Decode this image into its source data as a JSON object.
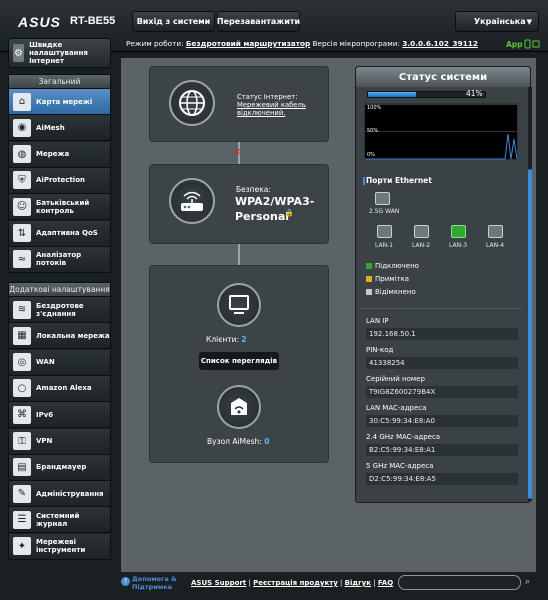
{
  "header": {
    "brand": "ASUS",
    "model": "RT-BE55",
    "logout_label": "Вихід з системи",
    "reboot_label": "Перезавантажити",
    "language": "Українська",
    "status_prefix": "Режим роботи:",
    "mode": "Бездротовий маршрутизатор",
    "fw_prefix": "Версія мікропрограми:",
    "firmware": "3.0.0.6.102_39112",
    "app_label": "App"
  },
  "sidebar": {
    "quick_setup": "Швидке налаштування Інтернет",
    "general_header": "Загальний",
    "general_items": [
      {
        "label": "Карта мережі",
        "icon": "network-map-icon"
      },
      {
        "label": "AiMesh",
        "icon": "aimesh-icon"
      },
      {
        "label": "Мережа",
        "icon": "globe-icon"
      },
      {
        "label": "AiProtection",
        "icon": "shield-icon"
      },
      {
        "label": "Батьківський контроль",
        "icon": "parental-icon"
      },
      {
        "label": "Адаптивна QoS",
        "icon": "qos-icon"
      },
      {
        "label": "Аналізатор потоків",
        "icon": "traffic-icon"
      }
    ],
    "advanced_header": "Додаткові налаштування",
    "advanced_items": [
      {
        "label": "Бездротове з'єднання",
        "icon": "wireless-icon"
      },
      {
        "label": "Локальна мережа",
        "icon": "lan-icon"
      },
      {
        "label": "WAN",
        "icon": "wan-icon"
      },
      {
        "label": "Amazon Alexa",
        "icon": "alexa-icon"
      },
      {
        "label": "IPv6",
        "icon": "ipv6-icon"
      },
      {
        "label": "VPN",
        "icon": "vpn-icon"
      },
      {
        "label": "Брандмауер",
        "icon": "firewall-icon"
      },
      {
        "label": "Адміністрування",
        "icon": "admin-icon"
      },
      {
        "label": "Системний журнал",
        "icon": "log-icon"
      },
      {
        "label": "Мережеві інструменти",
        "icon": "tools-icon"
      }
    ]
  },
  "map": {
    "internet_status_label": "Статус Інтернет:",
    "internet_status": "Мережевий кабель відключений.",
    "security_label": "Безпека:",
    "security_value": "WPA2/WPA3-Personal",
    "clients_label": "Клієнти:",
    "clients_count": "2",
    "view_list": "Список переглядів",
    "aimesh_label": "Вузол AiMesh:",
    "aimesh_count": "0"
  },
  "status": {
    "title": "Статус системи",
    "cpu_percent": 41,
    "cpu_percent_label": "41%",
    "graph_labels": [
      "100%",
      "50%",
      "0%"
    ],
    "ethernet_title": "Порти Ethernet",
    "wan_label": "2.5G WAN",
    "lan_ports": [
      {
        "label": "LAN-1",
        "connected": false
      },
      {
        "label": "LAN-2",
        "connected": false
      },
      {
        "label": "LAN-3",
        "connected": true
      },
      {
        "label": "LAN-4",
        "connected": false
      }
    ],
    "legend": [
      {
        "label": "Підключено",
        "color": "#2faa2f"
      },
      {
        "label": "Примітка",
        "color": "#e0b020"
      },
      {
        "label": "Відімкнено",
        "color": "#c8c8c8"
      }
    ],
    "info": [
      {
        "label": "LAN IP",
        "value": "192.168.50.1"
      },
      {
        "label": "PIN-код",
        "value": "41338254"
      },
      {
        "label": "Серійний номер",
        "value": "T9IG8Z600279B4X"
      },
      {
        "label": "LAN MAC-адреса",
        "value": "30:C5:99:34:E8:A0"
      },
      {
        "label": "2.4 GHz MAC-адреса",
        "value": "B2:C5:99:34:E8:A1"
      },
      {
        "label": "5 GHz MAC-адреса",
        "value": "D2:C5:99:34:E8:A5"
      }
    ]
  },
  "footer": {
    "help": "Допомога & Підтримка",
    "support": "ASUS Support",
    "register": "Реєстрація продукту",
    "feedback": "Відгук",
    "faq": "FAQ",
    "sep": " | "
  },
  "colors": {
    "accent": "#3a8dde",
    "connected": "#2faa2f",
    "error": "#e02020"
  }
}
